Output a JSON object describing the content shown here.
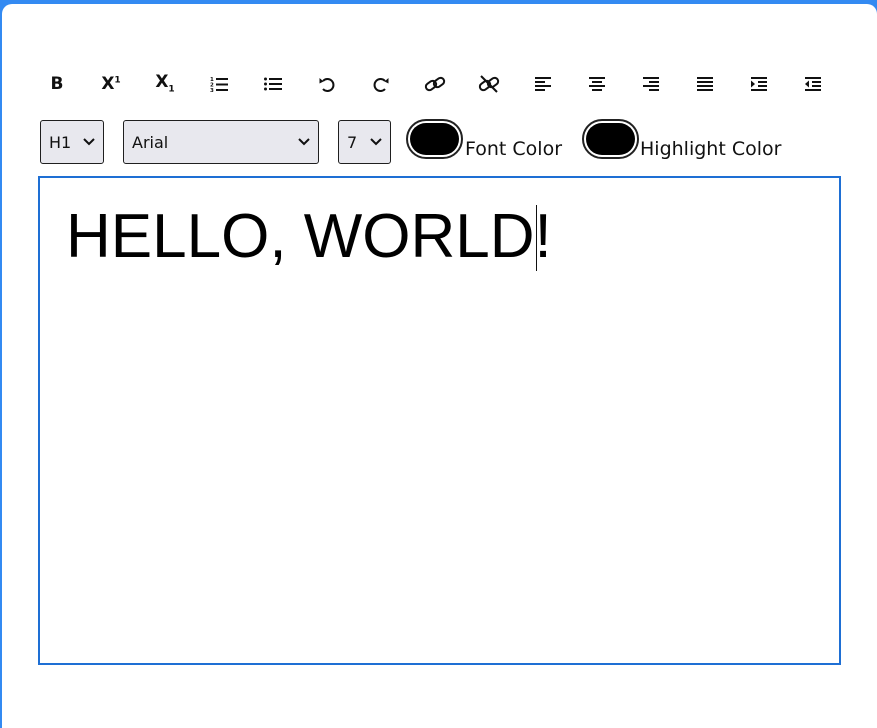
{
  "toolbar": {
    "buttons": [
      {
        "name": "bold",
        "label": "B"
      },
      {
        "name": "superscript",
        "label": "X",
        "mark": "1"
      },
      {
        "name": "subscript",
        "label": "X",
        "mark": "1"
      },
      {
        "name": "ordered-list"
      },
      {
        "name": "unordered-list"
      },
      {
        "name": "undo"
      },
      {
        "name": "redo"
      },
      {
        "name": "link"
      },
      {
        "name": "unlink"
      },
      {
        "name": "align-left"
      },
      {
        "name": "align-center"
      },
      {
        "name": "align-right"
      },
      {
        "name": "justify"
      },
      {
        "name": "indent"
      },
      {
        "name": "outdent"
      }
    ]
  },
  "controls": {
    "heading_select": {
      "value": "H1"
    },
    "font_select": {
      "value": "Arial"
    },
    "size_select": {
      "value": "7"
    },
    "font_color": {
      "label": "Font Color",
      "color": "#000000"
    },
    "highlight_color": {
      "label": "Highlight Color",
      "color": "#000000"
    }
  },
  "editor": {
    "content": "HELLO, WORLD!",
    "border_color": "#1e6fd4"
  },
  "colors": {
    "page_background": "#338af2",
    "card_background": "#ffffff"
  }
}
